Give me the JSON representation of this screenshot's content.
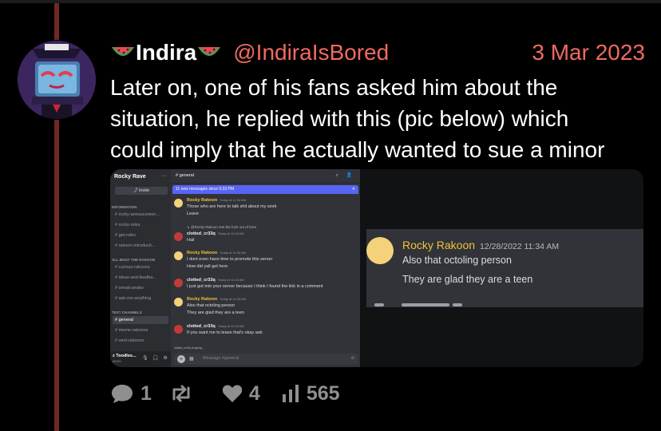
{
  "post": {
    "display_name": "Indira",
    "handle": "@IndiraIsBored",
    "date": "3 Mar 2023",
    "text_lines": [
      "Later on, one of his fans asked him about the",
      "situation, he replied with this (pic below) which",
      "could imply that he actually wanted to sue a minor"
    ]
  },
  "discord": {
    "server_name": "Rocky Rave",
    "invite_label": "Invite",
    "channel_header": "general",
    "new_messages_banner": "11 new messages since 5:33 PM",
    "categories": [
      "INFORMATION",
      "ALL BOUT THE RAKOON",
      "TEXT CHANNELS"
    ],
    "channels": [
      "rocky-annoucemen...",
      "rocky-rules",
      "get-roles",
      "rakoon-introducti...",
      "curious-rakoons",
      "ideas-and-feedba...",
      "sneak-peaks",
      "ask-me-anything",
      "general",
      "meme-rakoons",
      "vent-rakoons"
    ],
    "user": {
      "name": "z Toodles...",
      "status": "#0001"
    },
    "messages": [
      {
        "author": "Rocky Rakoon",
        "time": "Today at 11:34 AM",
        "lines": [
          "Those who are here to talk shit about my work",
          "Leave"
        ]
      },
      {
        "reply": "@Rocky Rakoon Get the fuck out of here"
      },
      {
        "author": "clotted_cr33q",
        "time": "Today at 11:34 AM",
        "lines": [
          "Hail"
        ]
      },
      {
        "author": "Rocky Rakoon",
        "time": "Today at 11:34 AM",
        "lines": [
          "I dont even have time to promote this server",
          "How did yall get here"
        ]
      },
      {
        "author": "clotted_cr33q",
        "time": "Today at 11:34 AM",
        "lines": [
          "I just got into your server because I think I found the link in a comment"
        ]
      },
      {
        "author": "Rocky Rakoon",
        "time": "Today at 11:34 AM",
        "lines": [
          "Also that octoling person",
          "They are glad they are a teen"
        ]
      },
      {
        "author": "clotted_cr33q",
        "time": "Today at 11:34 AM",
        "lines": [
          "If you want me to leave that's okay asb"
        ]
      }
    ],
    "typing": "clotted_cr33q is typing...",
    "composer_placeholder": "Message #general"
  },
  "zoom": {
    "author": "Rocky Rakoon",
    "time": "12/28/2022 11:34 AM",
    "line1": "Also that octoling person",
    "line2": "They are glad they are a teen"
  },
  "actions": {
    "replies": "1",
    "likes": "4",
    "views": "565"
  },
  "colors": {
    "accent": "#f06a5f",
    "thread_line": "#6e2a22",
    "action_gray": "#8f8f8f",
    "discord_blurple": "#5865f2"
  }
}
